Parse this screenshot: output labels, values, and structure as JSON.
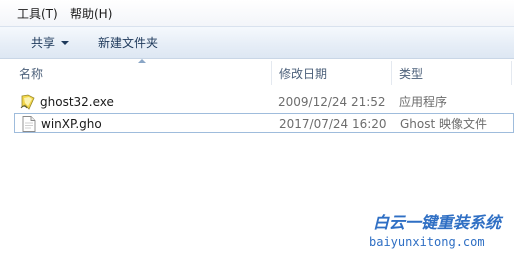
{
  "menubar": {
    "items": [
      {
        "label": "工具(T)"
      },
      {
        "label": "帮助(H)"
      }
    ]
  },
  "toolbar": {
    "share_label": "共享",
    "new_folder_label": "新建文件夹"
  },
  "columns": {
    "name": "名称",
    "date_modified": "修改日期",
    "type": "类型"
  },
  "files": [
    {
      "name": "ghost32.exe",
      "date": "2009/12/24 21:52",
      "type": "应用程序",
      "icon": "ghost-app-icon"
    },
    {
      "name": "winXP.gho",
      "date": "2017/07/24 16:20",
      "type": "Ghost 映像文件",
      "icon": "document-file-icon"
    }
  ],
  "watermark": {
    "title": "白云一键重装系统",
    "url": "baiyunxitong.com"
  },
  "colors": {
    "toolbar_text": "#1e395b",
    "selection_border": "#9fbcdc",
    "watermark": "#2f6fc4"
  }
}
